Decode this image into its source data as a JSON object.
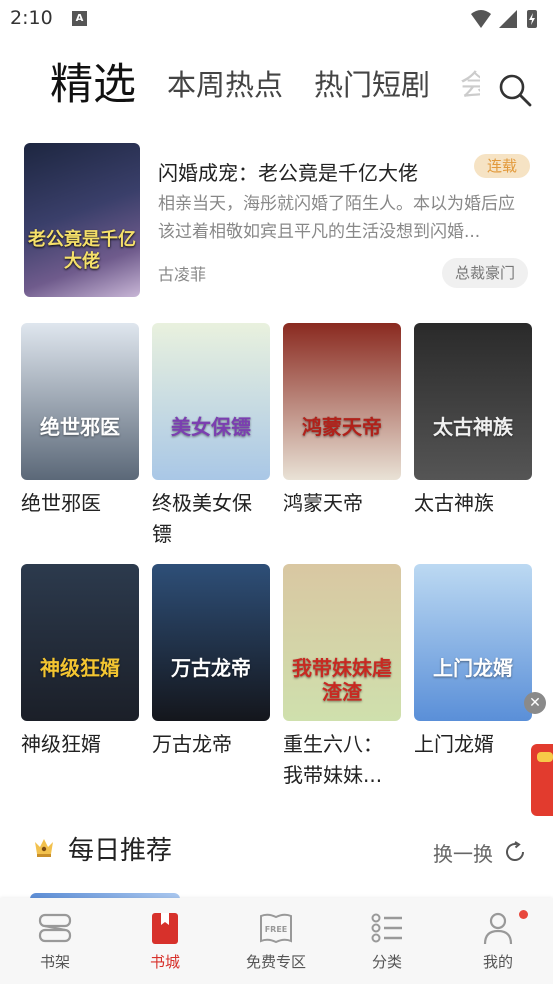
{
  "status_bar": {
    "time": "2:10",
    "notification_glyph": "A"
  },
  "tabs": [
    {
      "label": "精选",
      "active": true
    },
    {
      "label": "本周热点",
      "active": false
    },
    {
      "label": "热门短剧",
      "active": false
    },
    {
      "label": "会",
      "active": false
    }
  ],
  "featured": {
    "cover_text": "老公竟是千亿大佬",
    "title": "闪婚成宠：老公竟是千亿大佬",
    "status_badge": "连载",
    "description": "相亲当天，海彤就闪婚了陌生人。本以为婚后应该过着相敬如宾且平凡的生活没想到闪婚...",
    "author": "古凌菲",
    "genre": "总裁豪门"
  },
  "books": [
    {
      "title": "绝世邪医",
      "cover_text": "绝世邪医",
      "cover_top": "#dfe6ee",
      "cover_bottom": "#5b6878",
      "cover_text_color": "#ffffff"
    },
    {
      "title": "终极美女保镖",
      "cover_text": "美女保镖",
      "cover_top": "#e9f1de",
      "cover_bottom": "#a9c7e6",
      "cover_text_color": "#7b3fb0"
    },
    {
      "title": "鸿蒙天帝",
      "cover_text": "鸿蒙天帝",
      "cover_top": "#8a2a20",
      "cover_bottom": "#e9e2d6",
      "cover_text_color": "#b0211a"
    },
    {
      "title": "太古神族",
      "cover_text": "太古神族",
      "cover_top": "#2a2a2a",
      "cover_bottom": "#555555",
      "cover_text_color": "#f0f0f0"
    },
    {
      "title": "神级狂婿",
      "cover_text": "神级狂婿",
      "cover_top": "#2c3a4d",
      "cover_bottom": "#1b1f28",
      "cover_text_color": "#f3c531"
    },
    {
      "title": "万古龙帝",
      "cover_text": "万古龙帝",
      "cover_top": "#2e4f78",
      "cover_bottom": "#14161c",
      "cover_text_color": "#ffffff"
    },
    {
      "title": "重生六八：我带妹妹...",
      "cover_text": "我带妹妹虐渣渣",
      "cover_top": "#d9c7a2",
      "cover_bottom": "#cfe0ad",
      "cover_text_color": "#c72a22"
    },
    {
      "title": "上门龙婿",
      "cover_text": "上门龙婿",
      "cover_top": "#bcd9f2",
      "cover_bottom": "#5a8fd8",
      "cover_text_color": "#ffffff"
    }
  ],
  "daily": {
    "title": "每日推荐",
    "refresh_label": "换一换"
  },
  "bottom_nav": [
    {
      "label": "书架",
      "icon": "bookshelf-icon",
      "active": false
    },
    {
      "label": "书城",
      "icon": "bookstore-icon",
      "active": true
    },
    {
      "label": "免费专区",
      "icon": "free-book-icon",
      "active": false,
      "icon_text": "FREE"
    },
    {
      "label": "分类",
      "icon": "category-list-icon",
      "active": false
    },
    {
      "label": "我的",
      "icon": "profile-icon",
      "active": false,
      "has_dot": true
    }
  ],
  "colors": {
    "accent_red": "#d7312b",
    "serial_badge_bg": "#f6e3c4",
    "serial_badge_text": "#e29a3c"
  }
}
